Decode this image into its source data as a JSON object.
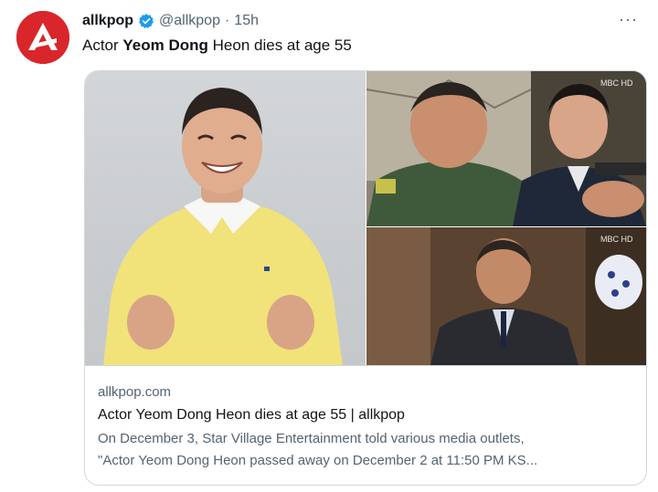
{
  "tweet": {
    "author_name": "allkpop",
    "handle": "@allkpop",
    "separator": "·",
    "time": "15h",
    "more_label": "···",
    "text_prefix": "Actor ",
    "text_bold": "Yeom Dong",
    "text_suffix": " Heon dies at age 55"
  },
  "card": {
    "domain": "allkpop.com",
    "title": "Actor Yeom Dong Heon dies at age 55 | allkpop",
    "description_line1": "On December 3, Star Village Entertainment told various media outlets,",
    "description_line2": "\"Actor Yeom Dong Heon passed away on December 2 at 11:50 PM KS...",
    "watermark_top": "MBC HD",
    "watermark_bottom": "MBC HD"
  },
  "colors": {
    "brand_red": "#d8262b",
    "verified_blue": "#1d9bf0",
    "text_primary": "#0f1419",
    "text_secondary": "#536471",
    "border": "#cfd9de"
  },
  "icons": {
    "avatar": "allkpop-logo-icon",
    "verified": "verified-badge-icon",
    "more": "more-options-icon"
  }
}
